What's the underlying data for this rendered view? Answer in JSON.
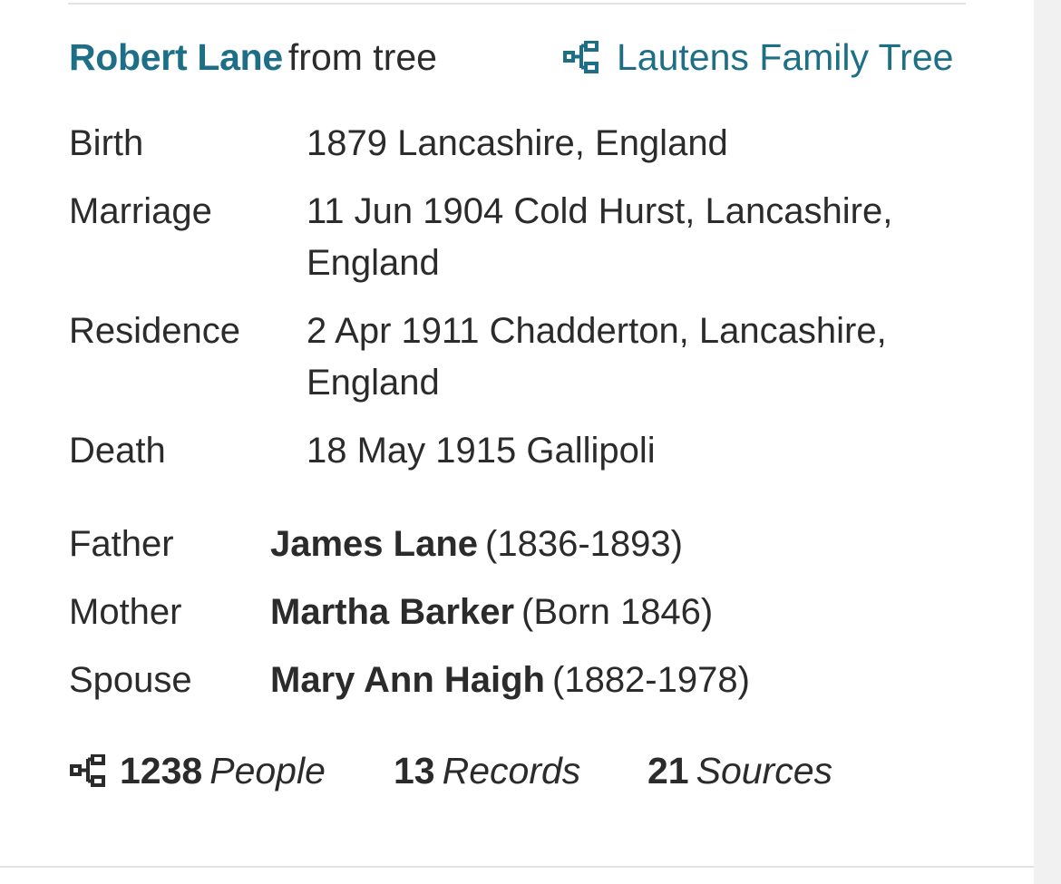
{
  "header": {
    "person_name": "Robert Lane",
    "from_text": "from tree",
    "tree_name": "Lautens Family Tree",
    "tree_icon": "family-tree-icon"
  },
  "facts": [
    {
      "label": "Birth",
      "value": "1879 Lancashire, England"
    },
    {
      "label": "Marriage",
      "value": "11 Jun 1904 Cold Hurst, Lancashire, England"
    },
    {
      "label": "Residence",
      "value": "2 Apr 1911 Chadderton, Lancashire, England"
    },
    {
      "label": "Death",
      "value": "18 May 1915 Gallipoli"
    }
  ],
  "relations": [
    {
      "label": "Father",
      "name": "James Lane",
      "dates": "(1836-1893)"
    },
    {
      "label": "Mother",
      "name": "Martha Barker",
      "dates": "(Born 1846)"
    },
    {
      "label": "Spouse",
      "name": "Mary Ann Haigh",
      "dates": "(1882-1978)"
    }
  ],
  "stats": {
    "people_count": "1238",
    "people_label": "People",
    "records_count": "13",
    "records_label": "Records",
    "sources_count": "21",
    "sources_label": "Sources"
  },
  "colors": {
    "link": "#1d6f87",
    "text": "#2b2b2b",
    "rule": "#e3e3e3"
  }
}
